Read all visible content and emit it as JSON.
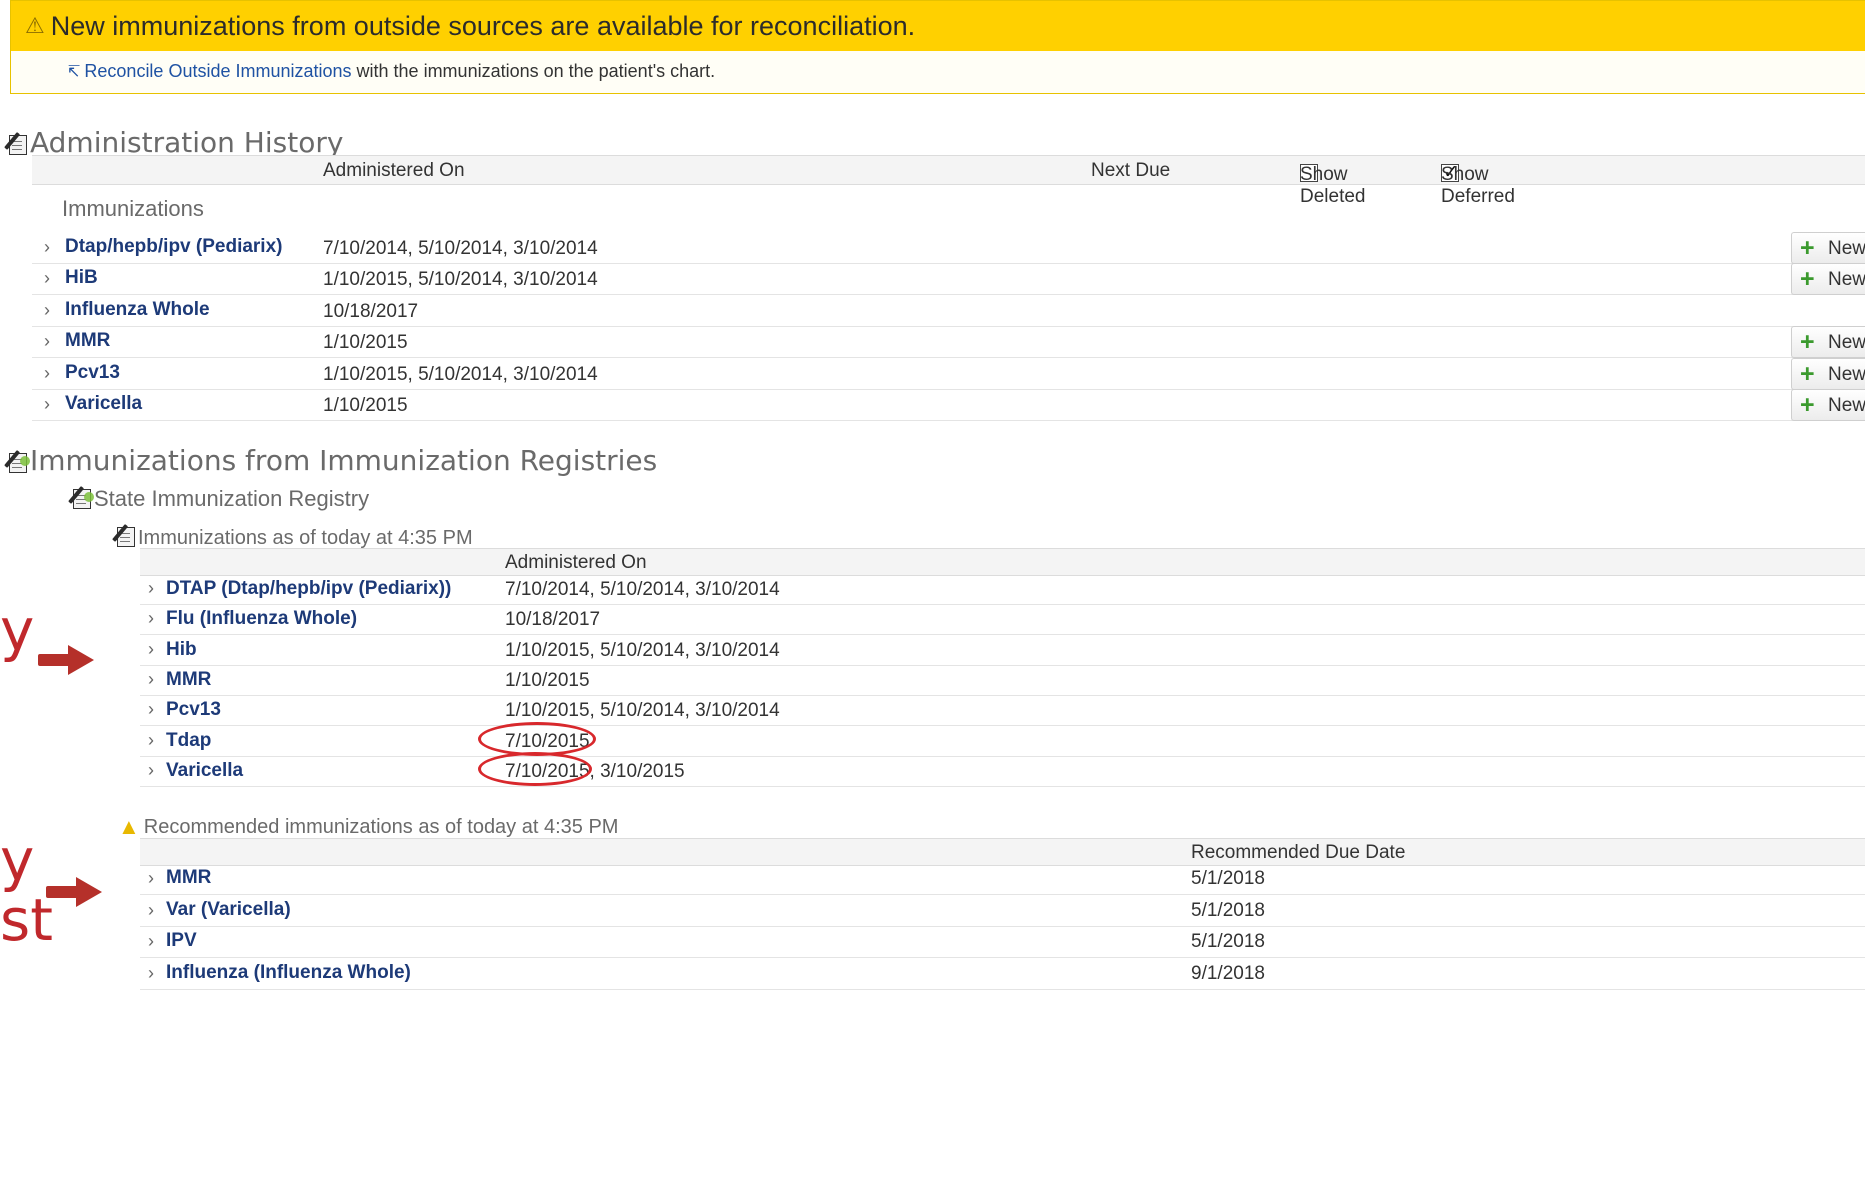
{
  "banner": {
    "title": "New immunizations from outside sources are available for reconciliation.",
    "link_text": "Reconcile Outside Immunizations",
    "rest_text": " with the immunizations on the patient's chart."
  },
  "admin_history": {
    "title": "Administration History",
    "col_administered": "Administered On",
    "col_next_due": "Next Due",
    "show_deleted_label": "Show Deleted",
    "show_deleted_checked": false,
    "show_deferred_label": "Show Deferred",
    "show_deferred_checked": true,
    "group_label": "Immunizations",
    "new_button_label": "New",
    "rows": [
      {
        "name": "Dtap/hepb/ipv (Pediarix)",
        "dates": "7/10/2014, 5/10/2014, 3/10/2014",
        "has_new": true
      },
      {
        "name": "HiB",
        "dates": "1/10/2015, 5/10/2014, 3/10/2014",
        "has_new": true
      },
      {
        "name": "Influenza Whole",
        "dates": "10/18/2017",
        "has_new": false
      },
      {
        "name": "MMR",
        "dates": "1/10/2015",
        "has_new": true
      },
      {
        "name": "Pcv13",
        "dates": "1/10/2015, 5/10/2014, 3/10/2014",
        "has_new": true
      },
      {
        "name": "Varicella",
        "dates": "1/10/2015",
        "has_new": true
      }
    ]
  },
  "registries": {
    "title": "Immunizations from Immunization Registries",
    "registry_name": "State Immunization Registry",
    "immunizations_title": "Immunizations as of today at 4:35 PM",
    "col_administered": "Administered On",
    "rows": [
      {
        "name": "DTAP (Dtap/hepb/ipv (Pediarix))",
        "dates": "7/10/2014, 5/10/2014, 3/10/2014"
      },
      {
        "name": "Flu (Influenza Whole)",
        "dates": "10/18/2017"
      },
      {
        "name": "Hib",
        "dates": "1/10/2015, 5/10/2014, 3/10/2014"
      },
      {
        "name": "MMR",
        "dates": "1/10/2015"
      },
      {
        "name": "Pcv13",
        "dates": "1/10/2015, 5/10/2014, 3/10/2014"
      },
      {
        "name": "Tdap",
        "dates": "7/10/2015"
      },
      {
        "name": "Varicella",
        "dates": "7/10/2015, 3/10/2015"
      }
    ],
    "recommended_title": "Recommended immunizations as of today at 4:35 PM",
    "col_recommended_due": "Recommended Due Date",
    "recommended_rows": [
      {
        "name": "MMR",
        "date": "5/1/2018"
      },
      {
        "name": "Var (Varicella)",
        "date": "5/1/2018"
      },
      {
        "name": "IPV",
        "date": "5/1/2018"
      },
      {
        "name": "Influenza (Influenza Whole)",
        "date": "9/1/2018"
      }
    ]
  },
  "annotations": {
    "label_1": "y",
    "label_2a": "y",
    "label_2b": "st"
  },
  "icons": {
    "warning": "warning-icon",
    "reconcile": "reconcile-arrow-icon",
    "edit_document": "edit-document-icon",
    "add": "plus-icon",
    "expand": "chevron-right-icon"
  },
  "colors": {
    "banner_yellow": "#ffd000",
    "link_blue": "#1f52a3",
    "name_navy": "#1d3a78",
    "plus_green": "#3b9a2e",
    "annotation_red": "#c0282c"
  }
}
